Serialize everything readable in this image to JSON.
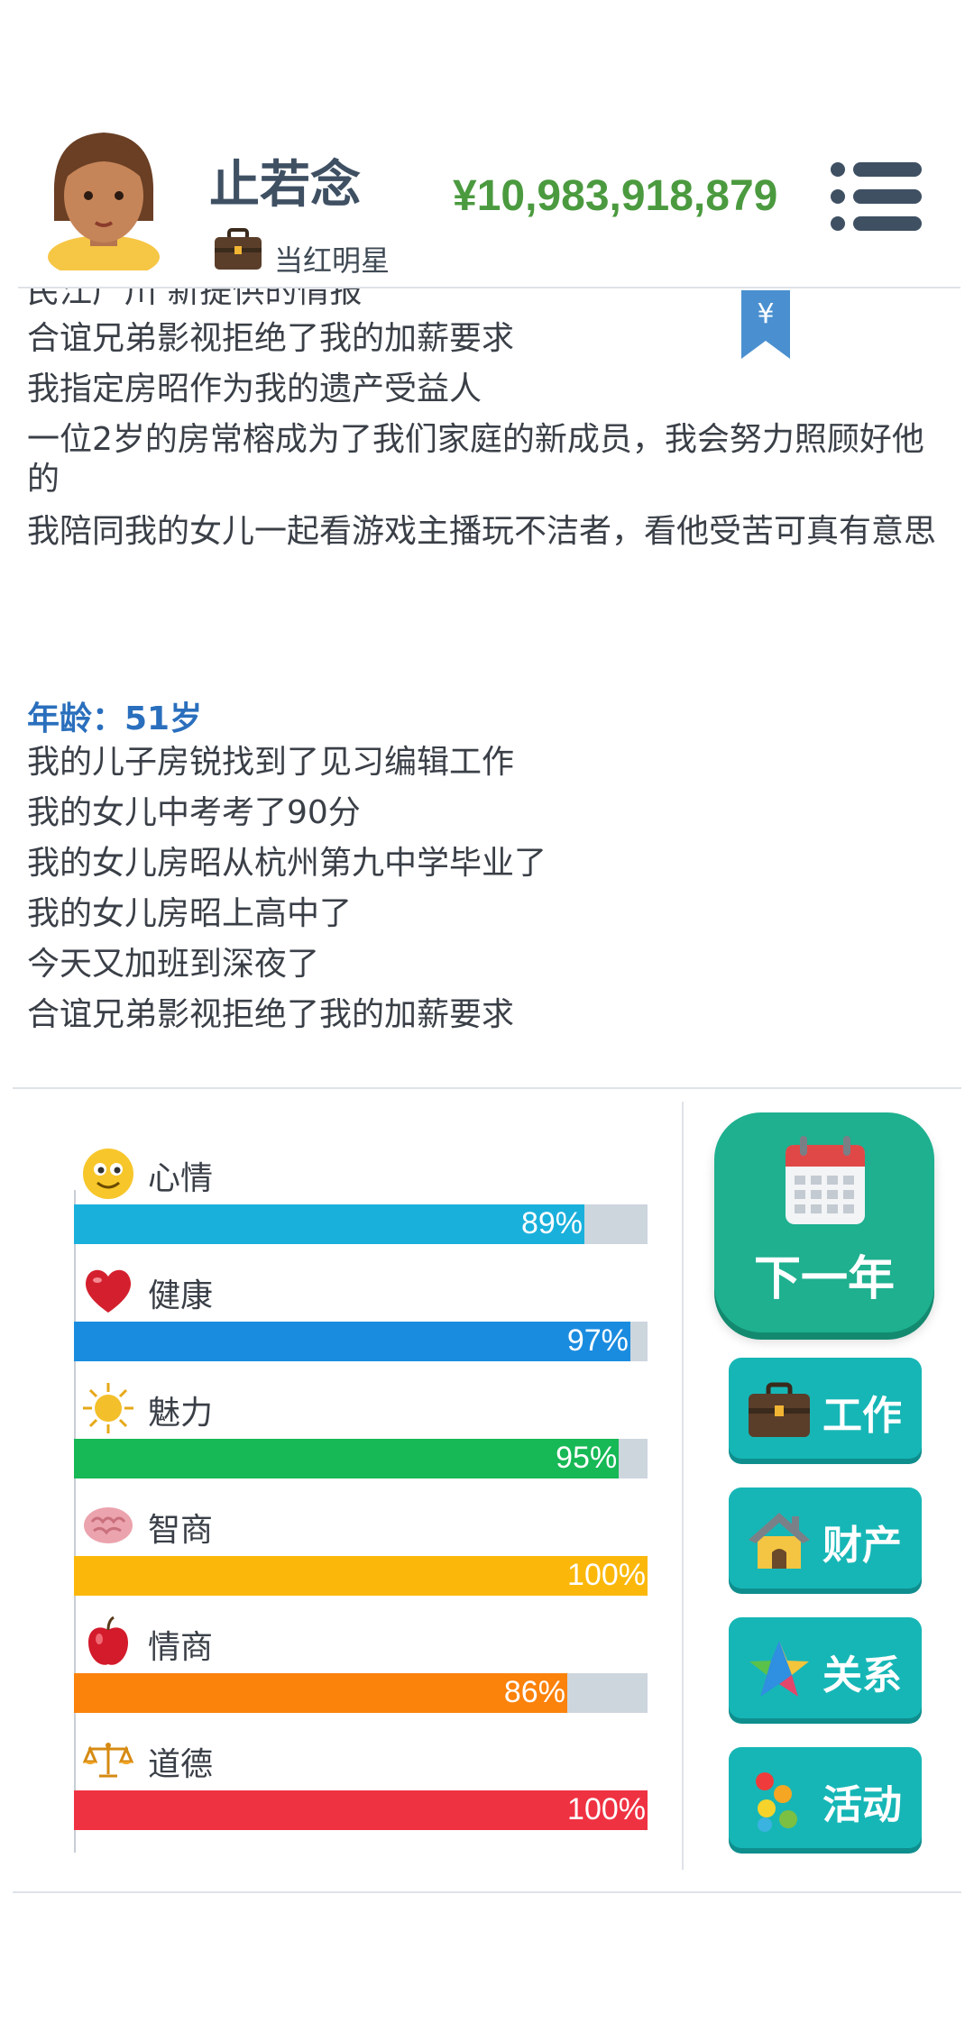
{
  "header": {
    "name": "止若念",
    "job_title": "当红明星",
    "money": "¥10,983,918,879"
  },
  "log": {
    "cut_line": "民江广川 新提供的情报",
    "lines_top": [
      "合谊兄弟影视拒绝了我的加薪要求",
      "我指定房昭作为我的遗产受益人",
      "一位2岁的房常榕成为了我们家庭的新成员，我会努力照顾好他的",
      "我陪同我的女儿一起看游戏主播玩不洁者，看他受苦可真有意思"
    ],
    "age_label": "年龄：51岁",
    "lines_bottom": [
      "我的儿子房锐找到了见习编辑工作",
      "我的女儿中考考了90分",
      "我的女儿房昭从杭州第九中学毕业了",
      "我的女儿房昭上高中了",
      "今天又加班到深夜了",
      "合谊兄弟影视拒绝了我的加薪要求"
    ]
  },
  "stats": [
    {
      "label": "心情",
      "value": 89,
      "text": "89%",
      "color": "#1ab0dc",
      "icon": "smiley-icon"
    },
    {
      "label": "健康",
      "value": 97,
      "text": "97%",
      "color": "#1a8ce0",
      "icon": "heart-icon"
    },
    {
      "label": "魅力",
      "value": 95,
      "text": "95%",
      "color": "#17b856",
      "icon": "sun-icon"
    },
    {
      "label": "智商",
      "value": 100,
      "text": "100%",
      "color": "#fbb80b",
      "icon": "brain-icon"
    },
    {
      "label": "情商",
      "value": 86,
      "text": "86%",
      "color": "#fb820b",
      "icon": "apple-icon"
    },
    {
      "label": "道德",
      "value": 100,
      "text": "100%",
      "color": "#ef3242",
      "icon": "scales-icon"
    }
  ],
  "actions": {
    "next_year": "下一年",
    "work": "工作",
    "assets": "财产",
    "relations": "关系",
    "activities": "活动"
  }
}
